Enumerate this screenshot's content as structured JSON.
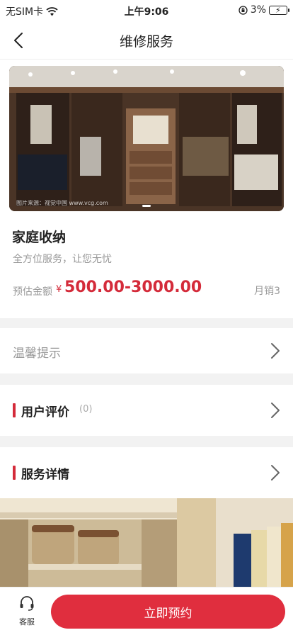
{
  "status_bar": {
    "carrier": "无SIM卡",
    "time": "上午9:06",
    "battery": "3%"
  },
  "nav": {
    "title": "维修服务"
  },
  "product": {
    "image_caption": "图片来源：视觉中国 www.vcg.com",
    "title": "家庭收纳",
    "subtitle": "全方位服务，让您无忧",
    "price_label": "预估金额",
    "price_symbol": "¥",
    "price": "500.00-3000.00",
    "sales": "月销3"
  },
  "sections": {
    "tip": "温馨提示",
    "review": "用户评价",
    "review_count": "(0)",
    "detail": "服务详情"
  },
  "bottom_bar": {
    "service_label": "客服",
    "book_label": "立即预约"
  },
  "colors": {
    "accent": "#e02e3e",
    "price": "#d42b3a"
  }
}
